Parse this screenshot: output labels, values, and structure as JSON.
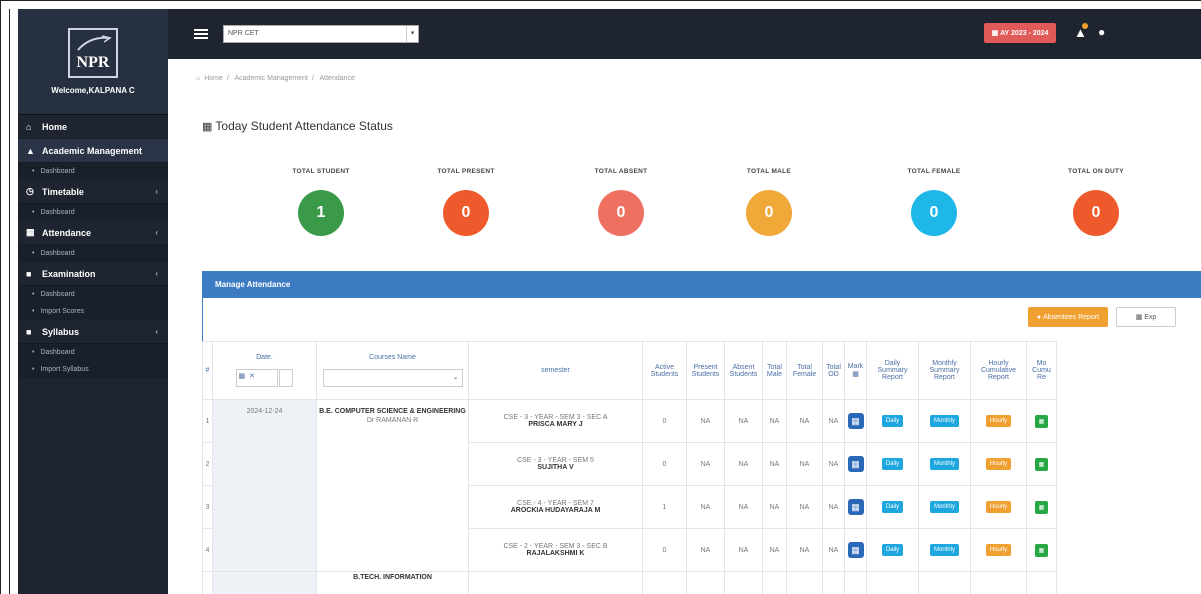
{
  "app": {
    "logo_text": "NPR",
    "welcome": "Welcome,KALPANA C"
  },
  "sidebar": {
    "items": [
      {
        "label": "Home",
        "icon": "home-icon"
      },
      {
        "label": "Academic Management",
        "icon": "graduation-cap-icon",
        "sub": [
          "Dashboard"
        ]
      },
      {
        "label": "Timetable",
        "icon": "clock-icon",
        "sub": [
          "Dashboard"
        ]
      },
      {
        "label": "Attendance",
        "icon": "calendar-icon",
        "sub": [
          "Dashboard"
        ]
      },
      {
        "label": "Examination",
        "icon": "book-icon",
        "sub": [
          "Dashboard",
          "Import Scores"
        ]
      },
      {
        "label": "Syllabus",
        "icon": "book-icon",
        "sub": [
          "Dashboard",
          "Import Syllabus"
        ]
      }
    ]
  },
  "topbar": {
    "college_select": "NPR CET",
    "academic_year": "AY 2023 - 2024"
  },
  "breadcrumb": [
    "Home",
    "Academic Management",
    "Attendance"
  ],
  "page_title": "Today Student Attendance Status",
  "stats": [
    {
      "label": "TOTAL STUDENT",
      "value": "1",
      "color": "#3a9a4a"
    },
    {
      "label": "TOTAL PRESENT",
      "value": "0",
      "color": "#ee5a2c"
    },
    {
      "label": "TOTAL ABSENT",
      "value": "0",
      "color": "#ee7060"
    },
    {
      "label": "TOTAL MALE",
      "value": "0",
      "color": "#f0a838"
    },
    {
      "label": "TOTAL FEMALE",
      "value": "0",
      "color": "#1fb6e8"
    },
    {
      "label": "TOTAL ON DUTY",
      "value": "0",
      "color": "#ee5a2c"
    }
  ],
  "panel": {
    "title": "Manage Attendance",
    "absentees_btn": "Absentees Report",
    "export_btn": "Exp"
  },
  "table": {
    "headers": [
      "#",
      "Date.",
      "Courses Name",
      "semester",
      "Active Students",
      "Present Students",
      "Absent Students",
      "Total Male",
      "Total Female",
      "Total OD",
      "Mark",
      "Daily Summary Report",
      "Monthly Summary Report",
      "Hourly Cumulative Report",
      "Mo Cumu Re"
    ],
    "rows": [
      {
        "num": "1",
        "semester": "CSE - 3 - YEAR - SEM 3 - SEC A",
        "faculty": "PRISCA MARY J",
        "active": "0",
        "present": "NA",
        "absent": "NA",
        "male": "NA",
        "female": "NA",
        "od": "NA"
      },
      {
        "num": "2",
        "semester": "CSE - 3 - YEAR - SEM 5",
        "faculty": "SUJITHA V",
        "active": "0",
        "present": "NA",
        "absent": "NA",
        "male": "NA",
        "female": "NA",
        "od": "NA"
      },
      {
        "num": "3",
        "semester": "CSE - 4 - YEAR - SEM 7",
        "faculty": "AROCKIA HUDAYARAJA M",
        "active": "1",
        "present": "NA",
        "absent": "NA",
        "male": "NA",
        "female": "NA",
        "od": "NA"
      },
      {
        "num": "4",
        "semester": "CSE - 2 - YEAR - SEM 3 - SEC B",
        "faculty": "RAJALAKSHMI K",
        "active": "0",
        "present": "NA",
        "absent": "NA",
        "male": "NA",
        "female": "NA",
        "od": "NA"
      }
    ],
    "date": "2024-12-24",
    "course": "B.E. COMPUTER SCIENCE & ENGINEERING",
    "hod": "Dr RAMANAN R",
    "next_course": "B.TECH. INFORMATION",
    "btn_daily": "Daily",
    "btn_monthly": "Monthly",
    "btn_hourly": "Hourly"
  }
}
